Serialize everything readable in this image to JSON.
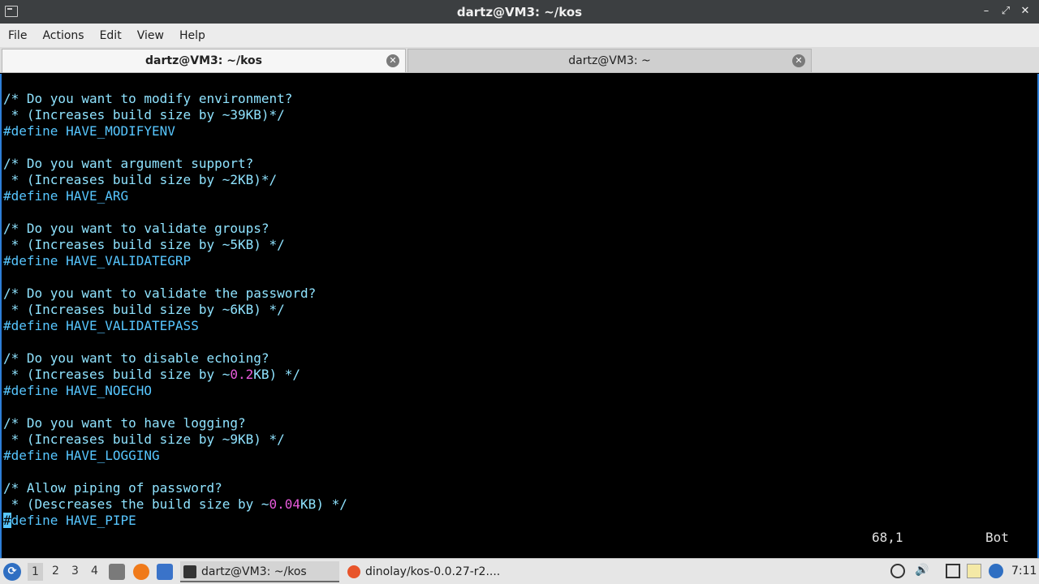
{
  "window": {
    "title": "dartz@VM3: ~/kos",
    "controls": {
      "minimize": "–",
      "maximize": "⤢",
      "close": "✕"
    }
  },
  "menu": [
    "File",
    "Actions",
    "Edit",
    "View",
    "Help"
  ],
  "tabs": [
    {
      "label": "dartz@VM3: ~/kos",
      "active": true
    },
    {
      "label": "dartz@VM3: ~",
      "active": false
    }
  ],
  "editor": {
    "lines": [
      {
        "parts": [
          {
            "t": "/* Do you want to modify environment?",
            "c": "comment"
          }
        ]
      },
      {
        "parts": [
          {
            "t": " * (Increases build size by ~39KB)*/",
            "c": "comment"
          }
        ]
      },
      {
        "parts": [
          {
            "t": "#define HAVE_MODIFYENV",
            "c": "define"
          }
        ]
      },
      {
        "parts": [
          {
            "t": "",
            "c": "text"
          }
        ]
      },
      {
        "parts": [
          {
            "t": "/* Do you want argument support?",
            "c": "comment"
          }
        ]
      },
      {
        "parts": [
          {
            "t": " * (Increases build size by ~2KB)*/",
            "c": "comment"
          }
        ]
      },
      {
        "parts": [
          {
            "t": "#define HAVE_ARG",
            "c": "define"
          }
        ]
      },
      {
        "parts": [
          {
            "t": "",
            "c": "text"
          }
        ]
      },
      {
        "parts": [
          {
            "t": "/* Do you want to validate groups?",
            "c": "comment"
          }
        ]
      },
      {
        "parts": [
          {
            "t": " * (Increases build size by ~5KB) */",
            "c": "comment"
          }
        ]
      },
      {
        "parts": [
          {
            "t": "#define HAVE_VALIDATEGRP",
            "c": "define"
          }
        ]
      },
      {
        "parts": [
          {
            "t": "",
            "c": "text"
          }
        ]
      },
      {
        "parts": [
          {
            "t": "/* Do you want to validate the password?",
            "c": "comment"
          }
        ]
      },
      {
        "parts": [
          {
            "t": " * (Increases build size by ~6KB) */",
            "c": "comment"
          }
        ]
      },
      {
        "parts": [
          {
            "t": "#define HAVE_VALIDATEPASS",
            "c": "define"
          }
        ]
      },
      {
        "parts": [
          {
            "t": "",
            "c": "text"
          }
        ]
      },
      {
        "parts": [
          {
            "t": "/* Do you want to disable echoing?",
            "c": "comment"
          }
        ]
      },
      {
        "parts": [
          {
            "t": " * (Increases build size by ~",
            "c": "comment"
          },
          {
            "t": "0.2",
            "c": "num"
          },
          {
            "t": "KB) */",
            "c": "comment"
          }
        ]
      },
      {
        "parts": [
          {
            "t": "#define HAVE_NOECHO",
            "c": "define"
          }
        ]
      },
      {
        "parts": [
          {
            "t": "",
            "c": "text"
          }
        ]
      },
      {
        "parts": [
          {
            "t": "/* Do you want to have logging?",
            "c": "comment"
          }
        ]
      },
      {
        "parts": [
          {
            "t": " * (Increases build size by ~9KB) */",
            "c": "comment"
          }
        ]
      },
      {
        "parts": [
          {
            "t": "#define HAVE_LOGGING",
            "c": "define"
          }
        ]
      },
      {
        "parts": [
          {
            "t": "",
            "c": "text"
          }
        ]
      },
      {
        "parts": [
          {
            "t": "/* Allow piping of password?",
            "c": "comment"
          }
        ]
      },
      {
        "parts": [
          {
            "t": " * (Descreases the build size by ~",
            "c": "comment"
          },
          {
            "t": "0.04",
            "c": "num"
          },
          {
            "t": "KB) */",
            "c": "comment"
          }
        ]
      },
      {
        "parts": [
          {
            "t": "#",
            "c": "cursor"
          },
          {
            "t": "define HAVE_PIPE",
            "c": "define"
          }
        ]
      }
    ],
    "cursor_position": "68,1",
    "scroll_position": "Bot"
  },
  "taskbar": {
    "start_icon": "lubuntu-start-icon",
    "workspaces": [
      "1",
      "2",
      "3",
      "4"
    ],
    "active_workspace": "1",
    "tasks": [
      {
        "label": "dartz@VM3: ~/kos",
        "icon": "terminal-icon",
        "active": true
      },
      {
        "label": "dinolay/kos-0.0.27-r2....",
        "icon": "firefox-icon",
        "active": false
      }
    ],
    "clock": "7:11"
  },
  "colors": {
    "accent": "#2e7fd8",
    "comment": "#8fe3ff",
    "define": "#57c6ff",
    "number": "#e85bdc"
  }
}
